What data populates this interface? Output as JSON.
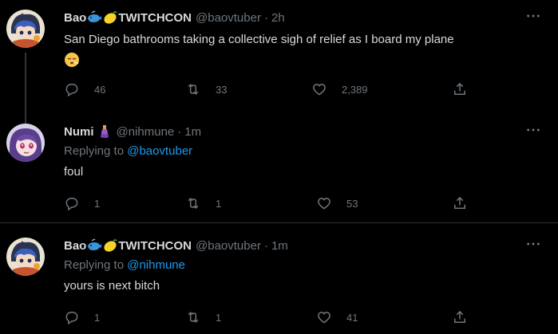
{
  "tweets": [
    {
      "name": "Bao",
      "handle": "@baovtuber",
      "sep": "·",
      "time": "2h",
      "title_suffix": "TWITCHCON",
      "text_line1": "San Diego bathrooms taking a collective sigh of relief as I board my plane",
      "text_emoji": "😮‍💨",
      "reply_count": "46",
      "retweet_count": "33",
      "like_count": "2,389",
      "more_icon": "more-icon"
    },
    {
      "name": "Numi",
      "handle": "@nihmune",
      "sep": "·",
      "time": "1m",
      "replying_prefix": "Replying to",
      "replying_to": "@baovtuber",
      "text": "foul",
      "reply_count": "1",
      "retweet_count": "1",
      "like_count": "53"
    },
    {
      "name": "Bao",
      "handle": "@baovtuber",
      "sep": "·",
      "time": "1m",
      "title_suffix": "TWITCHCON",
      "replying_prefix": "Replying to",
      "replying_to": "@nihmune",
      "text": "yours is next bitch",
      "reply_count": "1",
      "retweet_count": "1",
      "like_count": "41"
    }
  ],
  "colors": {
    "background": "#000000",
    "text": "#d9d9d9",
    "muted": "#6e767d",
    "link": "#1d9bf0",
    "divider": "#2f3336"
  }
}
